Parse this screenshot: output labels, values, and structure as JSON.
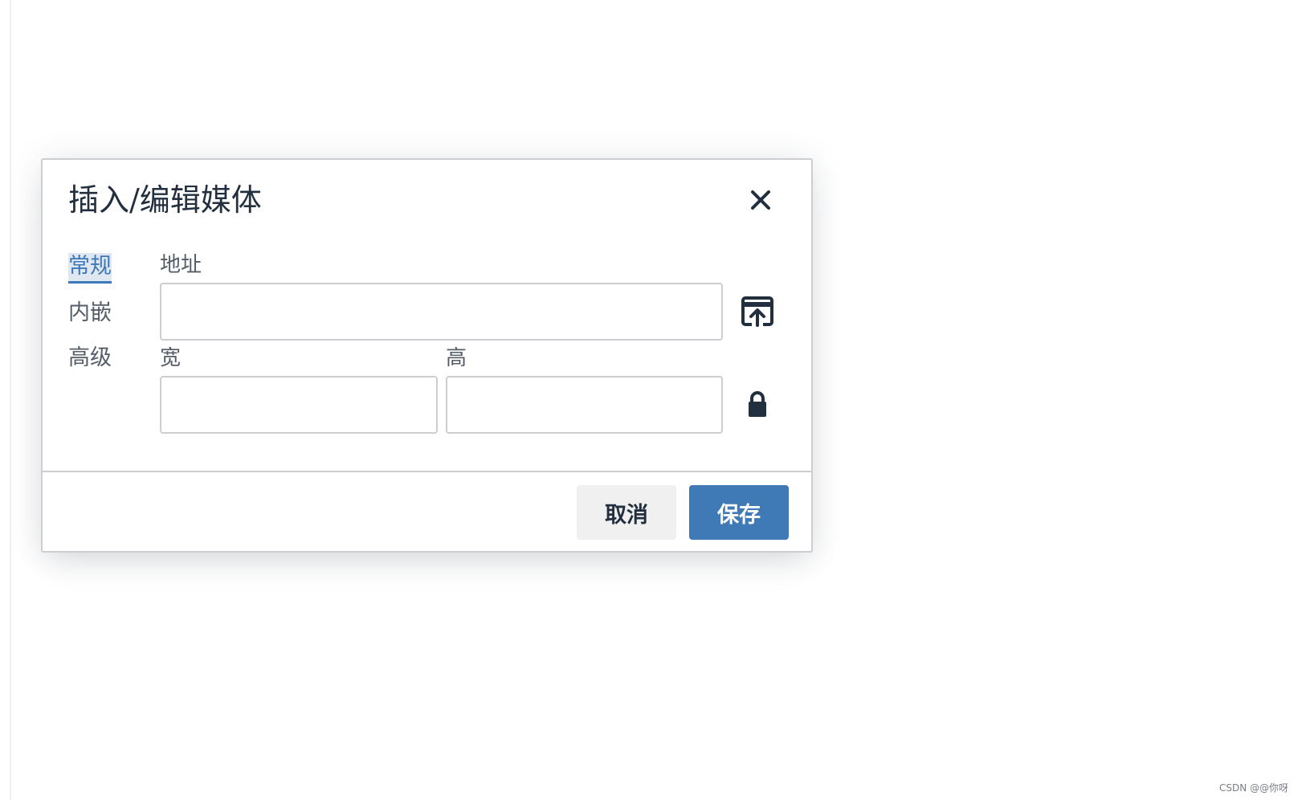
{
  "dialog": {
    "title": "插入/编辑媒体",
    "close_icon": "close-icon"
  },
  "tabs": [
    {
      "label": "常规",
      "active": true
    },
    {
      "label": "内嵌",
      "active": false
    },
    {
      "label": "高级",
      "active": false
    }
  ],
  "form": {
    "source": {
      "label": "地址",
      "value": "",
      "browse_icon": "upload-icon"
    },
    "width": {
      "label": "宽",
      "value": ""
    },
    "height": {
      "label": "高",
      "value": ""
    },
    "constrain_icon": "lock-icon"
  },
  "footer": {
    "cancel_label": "取消",
    "save_label": "保存"
  },
  "colors": {
    "primary": "#3f79b6",
    "text": "#222f3e",
    "border": "#ccced1"
  },
  "watermark": "CSDN @@你呀"
}
